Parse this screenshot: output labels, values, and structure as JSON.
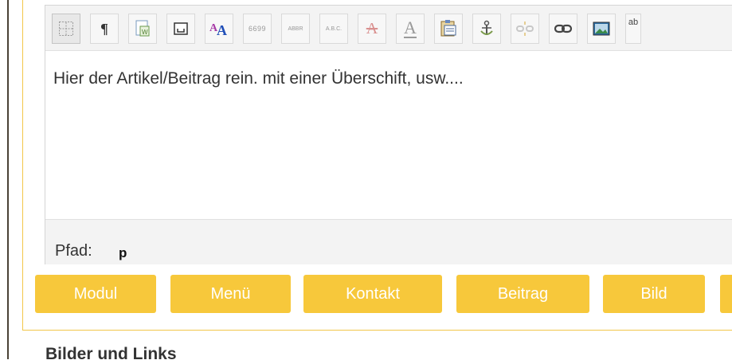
{
  "editor": {
    "content_text": "Hier der Artikel/Beitrag rein. mit einer Überschift, usw....",
    "path_label": "Pfad:",
    "path_value": "p",
    "toolbar_icons": [
      "table-grid-icon",
      "paragraph-icon",
      "paste-from-word-icon",
      "template-icon",
      "font-size-icon",
      "quote-icon",
      "abbreviation-icon",
      "acronym-icon",
      "strikethrough-icon",
      "text-color-icon",
      "clipboard-icon",
      "anchor-icon",
      "unlink-icon",
      "link-icon",
      "image-icon",
      "special-char-icon"
    ],
    "toolbar_glyphs": {
      "paragraph": "¶",
      "quote": "6699",
      "abbr": "ABBR",
      "abc": "A.B.C.",
      "letter_a": "A",
      "ab_small": "ab"
    }
  },
  "actions": {
    "buttons": [
      "Modul",
      "Menü",
      "Kontakt",
      "Beitrag",
      "Bild"
    ]
  },
  "section": {
    "heading": "Bilder und Links"
  },
  "colors": {
    "accent": "#f7c83b",
    "panel_border": "#f2c64a"
  }
}
